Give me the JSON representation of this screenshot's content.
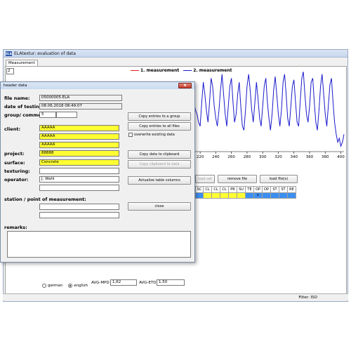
{
  "window": {
    "title": "ELAtextur: evaluation of data",
    "app_icon": "ELA"
  },
  "tab": {
    "label": "Measurement"
  },
  "measurement_number": "2",
  "legend": [
    {
      "label": "1. measurement",
      "color": "#e01b1b"
    },
    {
      "label": "2. measurement",
      "color": "#1a1acc"
    }
  ],
  "chart_data": {
    "type": "line",
    "xlabel": "",
    "ylabel": "",
    "x_ticks": [
      "220",
      "240",
      "260",
      "280",
      "300",
      "320",
      "340",
      "360",
      "380",
      "400"
    ],
    "xlim": [
      210,
      404
    ],
    "series": [
      {
        "name": "2. measurement",
        "color": "#1a1acc",
        "x": [
          210,
          212,
          214,
          216,
          218,
          220,
          222,
          224,
          226,
          228,
          230,
          232,
          234,
          236,
          238,
          240,
          242,
          244,
          246,
          248,
          250,
          252,
          254,
          256,
          258,
          260,
          262,
          264,
          266,
          268,
          270,
          272,
          274,
          276,
          278,
          280,
          282,
          284,
          286,
          288,
          290,
          292,
          294,
          296,
          298,
          300,
          302,
          304,
          306,
          308,
          310,
          312,
          314,
          316,
          318,
          320,
          322,
          324,
          326,
          328,
          330,
          332,
          334,
          336,
          338,
          340,
          342,
          344,
          346,
          348,
          350,
          352,
          354,
          356,
          358,
          360,
          362,
          364,
          366,
          368,
          370,
          372,
          374,
          376,
          378,
          380,
          382,
          384,
          386,
          388,
          390,
          392,
          394,
          396,
          398,
          400,
          402,
          404
        ],
        "y": [
          0.55,
          0.6,
          0.5,
          0.45,
          0.35,
          0.3,
          0.6,
          0.85,
          0.7,
          0.5,
          0.35,
          0.6,
          0.9,
          0.8,
          0.55,
          0.4,
          0.3,
          0.5,
          0.75,
          0.95,
          0.7,
          0.45,
          0.3,
          0.55,
          0.8,
          0.9,
          0.6,
          0.35,
          0.45,
          0.7,
          0.85,
          0.55,
          0.3,
          0.25,
          0.5,
          0.8,
          0.95,
          0.75,
          0.5,
          0.35,
          0.6,
          0.85,
          0.65,
          0.4,
          0.3,
          0.55,
          0.8,
          0.9,
          0.6,
          0.4,
          0.25,
          0.45,
          0.75,
          0.92,
          0.7,
          0.45,
          0.3,
          0.5,
          0.85,
          0.95,
          0.7,
          0.4,
          0.3,
          0.55,
          0.8,
          0.88,
          0.6,
          0.35,
          0.3,
          0.6,
          0.9,
          0.98,
          0.7,
          0.45,
          0.35,
          0.55,
          0.85,
          0.9,
          0.6,
          0.35,
          0.25,
          0.5,
          0.8,
          0.95,
          0.7,
          0.45,
          0.3,
          0.55,
          0.82,
          0.9,
          0.6,
          0.35,
          0.2,
          0.1,
          0.15,
          0.05,
          0.1,
          0.2
        ]
      }
    ]
  },
  "buttons_main": {
    "disabled_btn": "load set",
    "remove_file": "remove file",
    "load_files": "load file(s)"
  },
  "columns": [
    "SC",
    "CL",
    "CL",
    "CL",
    "PR",
    "SU",
    "TE",
    "OP",
    "OP",
    "ST",
    "ST",
    "RE"
  ],
  "column_cells": [
    "",
    "",
    "",
    "",
    "",
    "",
    "",
    "x",
    "",
    "",
    "",
    ""
  ],
  "column_cell_colors": [
    "blue",
    "yellow",
    "yellow",
    "yellow",
    "yellow",
    "yellow",
    "blue",
    "blue",
    "blue",
    "blue",
    "blue",
    "blue"
  ],
  "language": {
    "german": "german",
    "english": "english",
    "selected": "english"
  },
  "avg_mpd": {
    "label": "AVG-MPD",
    "value": "1,62"
  },
  "avg_etd": {
    "label": "AVG-ETD",
    "value": "1,50"
  },
  "status": {
    "filter": "Filter: ISO"
  },
  "dialog": {
    "title": "header data",
    "close_symbol": "x",
    "file_name_label": "file name:",
    "file_name": "05000005.ELA",
    "date_label": "date of testing:",
    "date": "08.06.2018 08:49:07",
    "group_label": "group/ commen",
    "group_value": "5",
    "client_label": "client:",
    "client_lines": [
      "AAAAA",
      "AAAAA",
      "AAAAA",
      ""
    ],
    "project_label": "project:",
    "project": "88888",
    "surface_label": "surface:",
    "surface": "Concrete",
    "texturing_label": "texturing:",
    "texturing": "",
    "operator_label": "operator:",
    "operator": "J. Wahl",
    "station_label": "station / point of measurement:",
    "remarks_label": "remarks:",
    "btn_copy_group": "Copy entries to a group",
    "btn_copy_all": "Copy entries to all files",
    "overwrite_label": "overwrite existing data",
    "btn_copy_clipboard": "Copy data to clipboard",
    "btn_copy_from_clipboard": "Copy clipboard to data",
    "btn_actualize": "Actualize table columns",
    "btn_close": "close"
  }
}
